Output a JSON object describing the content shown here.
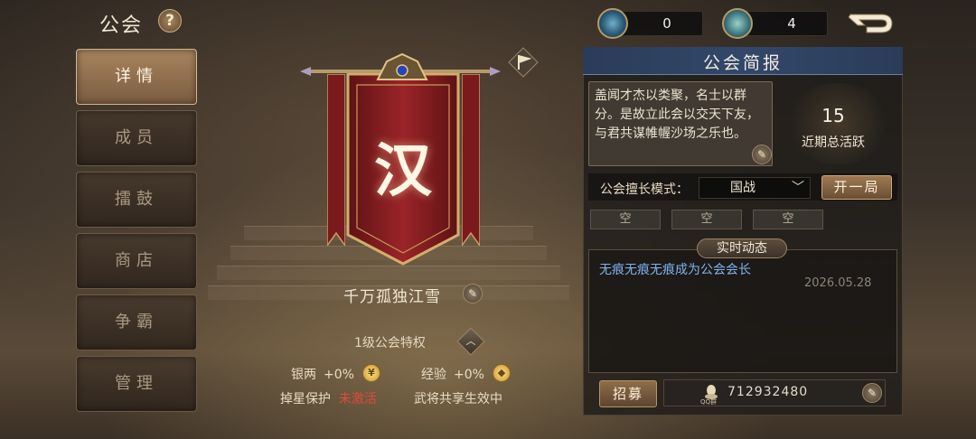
{
  "header": {
    "title": "公会",
    "help_label": "?",
    "currencies": [
      {
        "icon": "blue-medal-icon",
        "value": "0"
      },
      {
        "icon": "silver-medal-icon",
        "value": "4"
      }
    ]
  },
  "menu": {
    "items": [
      {
        "label": "详情",
        "active": true
      },
      {
        "label": "成员",
        "active": false
      },
      {
        "label": "擂鼓",
        "active": false
      },
      {
        "label": "商店",
        "active": false
      },
      {
        "label": "争霸",
        "active": false
      },
      {
        "label": "管理",
        "active": false
      }
    ]
  },
  "guild": {
    "emblem_char": "汉",
    "name": "千万孤独江雪",
    "privilege": "1级公会特权",
    "bonuses": [
      {
        "label": "银两",
        "value": "+0%"
      },
      {
        "label": "经验",
        "value": "+0%"
      }
    ],
    "status": [
      {
        "label": "掉星保护",
        "value": "未激活"
      },
      {
        "label": "武将共享生效中"
      }
    ]
  },
  "panel": {
    "title": "公会简报",
    "intro": "盖闻才杰以类聚，名士以群分。是故立此会以交天下友，与君共谋帷幄沙场之乐也。",
    "activity_value": "15",
    "activity_label": "近期总活跃",
    "mode_label": "公会擅长模式：",
    "mode_value": "国战",
    "start_label": "开一局",
    "slots": [
      "空",
      "空",
      "空"
    ],
    "feed_tag": "实时动态",
    "feed_text": "无痕无痕无痕成为公会会长",
    "feed_time": "2026.05.28",
    "recruit_label": "招募",
    "qq_label": "QQ群",
    "qq_number": "712932480"
  },
  "colors": {
    "accent_gold": "#c9a676",
    "feed_blue": "#7fb3f0",
    "inactive_red": "#e04a3a",
    "panel_header": "#2a3c58"
  }
}
